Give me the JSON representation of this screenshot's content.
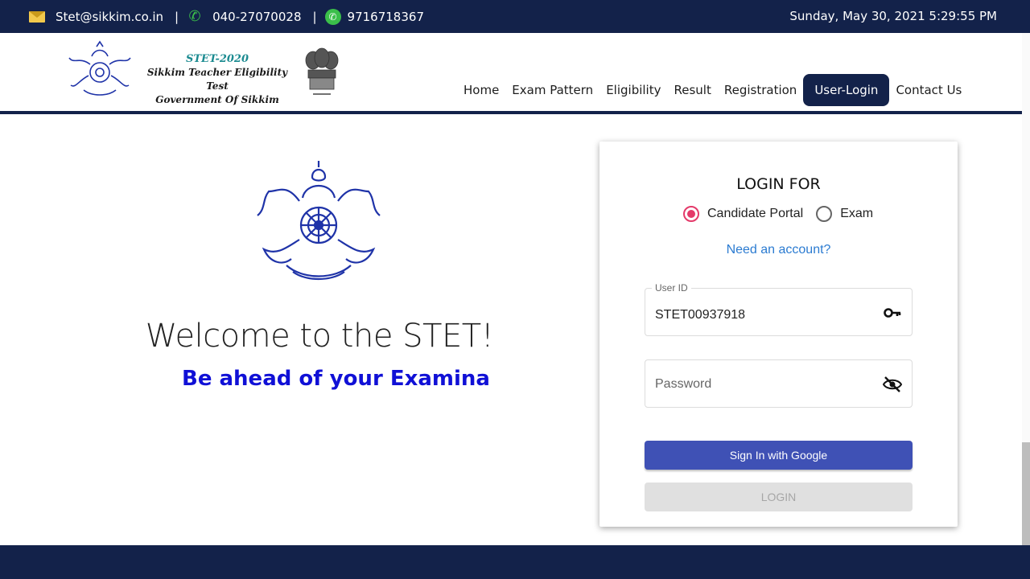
{
  "topbar": {
    "email": "Stet@sikkim.co.in",
    "separator": "|",
    "phone": "040-27070028",
    "whatsapp": "9716718367",
    "datetime": "Sunday, May 30, 2021 5:29:55 PM"
  },
  "brand": {
    "line1": "STET-2020",
    "line2": "Sikkim Teacher Eligibility Test",
    "line3": "Government Of Sikkim"
  },
  "nav": {
    "items": [
      "Home",
      "Exam Pattern",
      "Eligibility",
      "Result",
      "Registration",
      "User-Login",
      "Contact Us"
    ],
    "active": "User-Login"
  },
  "hero": {
    "welcome": "Welcome to the STET!",
    "tagline": "Be ahead of your Examina"
  },
  "login": {
    "title": "LOGIN FOR",
    "options": [
      "Candidate Portal",
      "Exam"
    ],
    "selected": "Candidate Portal",
    "need_account": "Need an account?",
    "userid_label": "User ID",
    "userid_value": "STET00937918",
    "password_placeholder": "Password",
    "google_button": "Sign In with Google",
    "login_button": "LOGIN"
  },
  "colors": {
    "navy": "#13224a",
    "accent_radio": "#e43a6a",
    "google_button": "#3f51b5",
    "link": "#2b7bd1",
    "tagline": "#1010d6"
  },
  "icons": [
    "mail-icon",
    "phone-icon",
    "whatsapp-icon",
    "key-icon",
    "eye-off-icon",
    "sikkim-emblem-icon",
    "ashoka-emblem-icon"
  ]
}
